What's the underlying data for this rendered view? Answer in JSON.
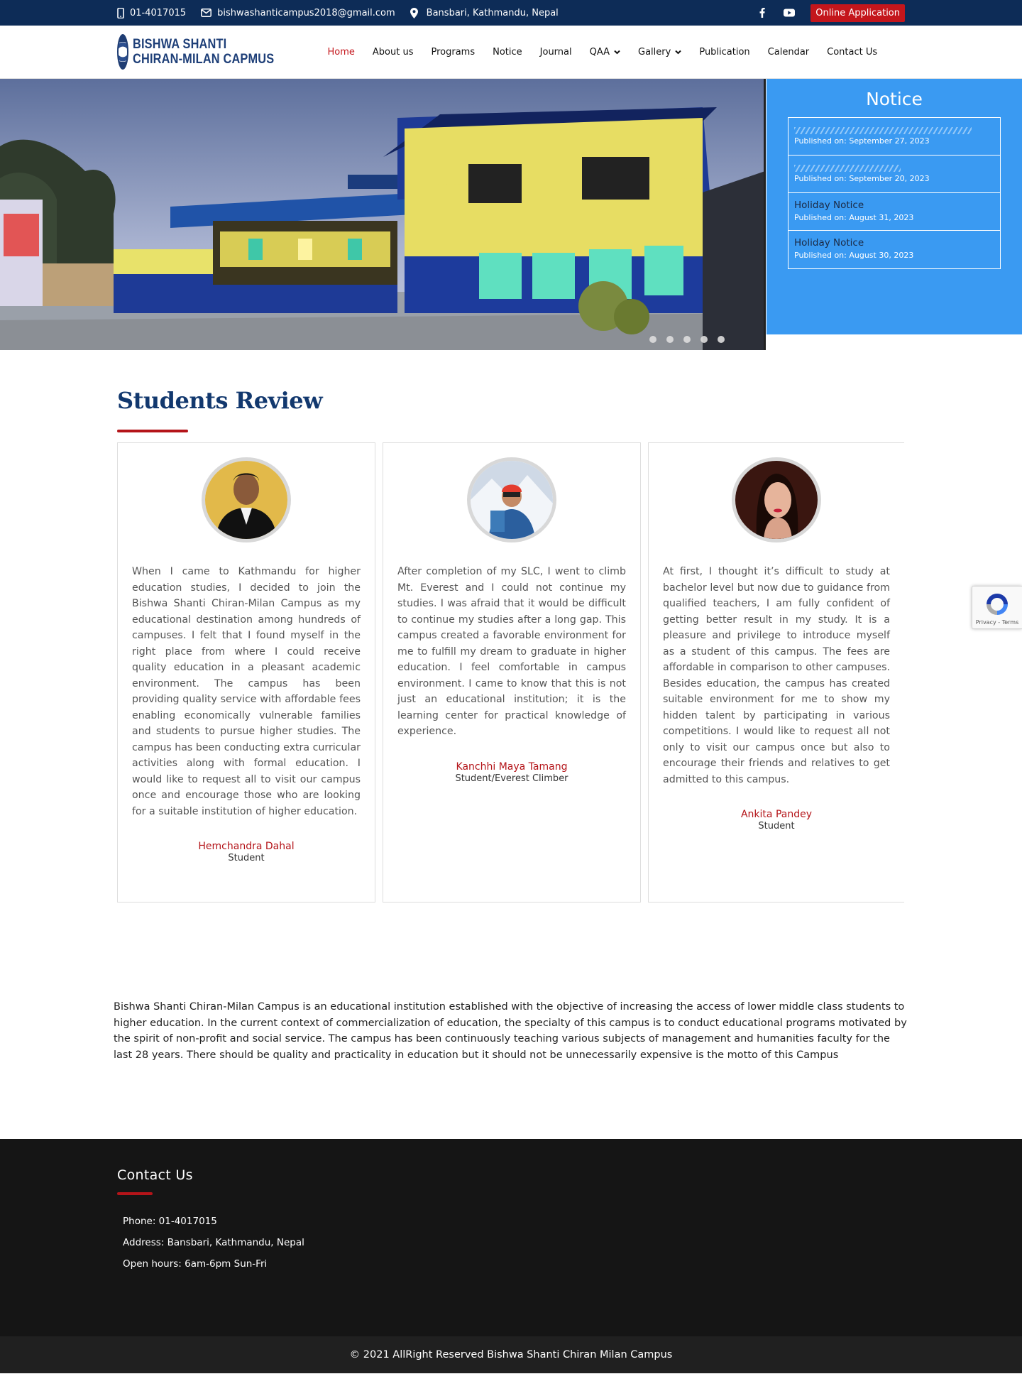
{
  "topbar": {
    "phone": "01-4017015",
    "email": "bishwashanticampus2018@gmail.com",
    "address": "Bansbari, Kathmandu, Nepal",
    "online_application": "Online Application",
    "social": [
      "facebook-icon",
      "youtube-icon"
    ]
  },
  "header": {
    "logo_line1": "BISHWA SHANTI",
    "logo_line2": "CHIRAN-MILAN CAPMUS",
    "nav": {
      "home": "Home",
      "about": "About us",
      "programs": "Programs",
      "notice": "Notice",
      "journal": "Journal",
      "qaa": "QAA",
      "gallery": "Gallery",
      "publication": "Publication",
      "calendar": "Calendar",
      "contact": "Contact Us"
    }
  },
  "notice_panel": {
    "title": "Notice",
    "items": [
      {
        "title": "",
        "date": "Published on: September 27, 2023"
      },
      {
        "title": "",
        "date": "Published on: September 20, 2023"
      },
      {
        "title": "Holiday Notice",
        "date": "Published on: August 31, 2023"
      },
      {
        "title": "Holiday Notice",
        "date": "Published on: August 30, 2023"
      }
    ]
  },
  "slider": {
    "slide_count": 5,
    "active_slide": 1
  },
  "reviews": {
    "heading": "Students Review",
    "items": [
      {
        "text": "When I came to Kathmandu for higher education studies, I decided to join the Bishwa Shanti Chiran-Milan Campus  as my educational destination among hundreds of campuses. I felt that I found myself in the right place from where I could receive quality education in a pleasant academic environment. The campus has been providing quality service with affordable fees enabling economically vulnerable families and students to pursue higher studies. The campus has been conducting extra curricular activities along with formal education. I would like to request all to visit our campus once and encourage those who are looking for a suitable institution of higher education.",
        "name": "Hemchandra Dahal",
        "role": "Student"
      },
      {
        "text": "After completion of my SLC, I went to climb Mt. Everest and I could not continue my studies. I was afraid that it would be difficult to continue my studies after a long gap.  This campus created a favorable environment for me to fulfill my dream to graduate in higher education. I feel comfortable in campus environment. I came to know that this is not just an educational institution; it is the learning center for practical knowledge of experience.",
        "name": "Kanchhi Maya Tamang",
        "role": "Student/Everest Climber"
      },
      {
        "text": "At first, I thought it’s difficult to study at bachelor level but now due to guidance from qualified teachers, I am fully confident of getting better result in my study. It is a pleasure and privilege to introduce myself as a student of this campus. The fees are affordable in comparison to other campuses. Besides education, the campus has created suitable environment for me to show my hidden talent by participating in various competitions. I would like to request all not only to visit our campus once but also to encourage their friends and relatives to get admitted to this campus.",
        "name": "Ankita Pandey",
        "role": "Student"
      }
    ]
  },
  "about": {
    "text": "Bishwa Shanti Chiran-Milan Campus is an educational institution established with the objective of increasing the access of lower middle class students to higher education. In the current context of commercialization of education, the specialty of this campus is to conduct educational programs motivated by the spirit of non-profit and social service. The campus has been continuously teaching various subjects of management and humanities faculty for the last 28 years. There should be quality and practicality in education but it should not be unnecessarily expensive is the motto of this Campus"
  },
  "footer": {
    "title": "Contact Us",
    "phone": "Phone: 01-4017015",
    "address": "Address: Bansbari, Kathmandu, Nepal",
    "hours": "Open hours: 6am-6pm Sun-Fri",
    "copyright": "© 2021 AllRight Reserved Bishwa Shanti Chiran Milan Campus"
  },
  "recaptcha": {
    "text": "Privacy - Terms"
  },
  "colors": {
    "navy": "#0d2c57",
    "red": "#c4161c",
    "notice_blue": "#3a9af2",
    "heading": "#12386e",
    "footer": "#151515"
  }
}
